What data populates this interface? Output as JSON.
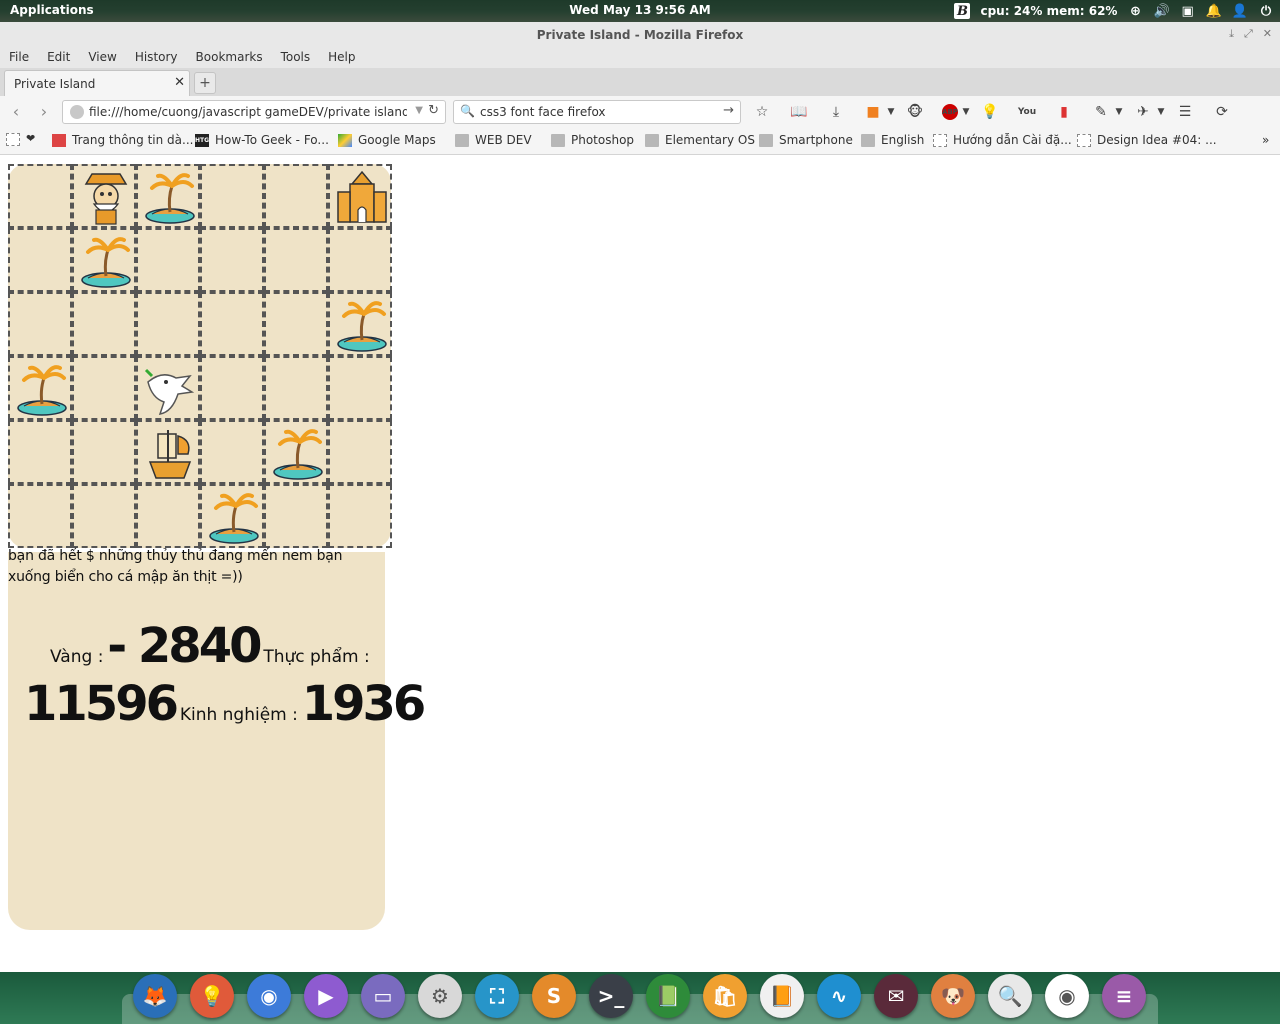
{
  "panel": {
    "apps_label": "Applications",
    "clock": "Wed May 13  9:56 AM",
    "stats": "cpu: 24% mem: 62%"
  },
  "window": {
    "title": "Private Island - Mozilla Firefox"
  },
  "menu": [
    "File",
    "Edit",
    "View",
    "History",
    "Bookmarks",
    "Tools",
    "Help"
  ],
  "tab": {
    "label": "Private Island"
  },
  "nav": {
    "url": "file:///home/cuong/javascript gameDEV/private island/index",
    "search": "css3 font face firefox"
  },
  "bookmarks": [
    {
      "label": "",
      "icon": "page"
    },
    {
      "label": "Trang thông tin dà...",
      "icon": "red"
    },
    {
      "label": "How-To Geek - Fo...",
      "icon": "htg"
    },
    {
      "label": "Google Maps",
      "icon": "maps"
    },
    {
      "label": "WEB DEV",
      "icon": "folder"
    },
    {
      "label": "Photoshop",
      "icon": "folder"
    },
    {
      "label": "Elementary OS",
      "icon": "folder"
    },
    {
      "label": "Smartphone",
      "icon": "folder"
    },
    {
      "label": "English",
      "icon": "folder"
    },
    {
      "label": "Hướng dẫn Cài đặ...",
      "icon": "page"
    },
    {
      "label": "Design Idea #04: ...",
      "icon": "page"
    }
  ],
  "map": {
    "grid_cols": 6,
    "grid_rows": 6,
    "tiles": [
      [
        "empty",
        "pirate",
        "island",
        "empty",
        "empty",
        "castle"
      ],
      [
        "empty",
        "island",
        "empty",
        "empty",
        "empty",
        "empty"
      ],
      [
        "empty",
        "empty",
        "empty",
        "empty",
        "empty",
        "island"
      ],
      [
        "island",
        "empty",
        "dragon",
        "empty",
        "empty",
        "empty"
      ],
      [
        "empty",
        "empty",
        "ship",
        "empty",
        "island",
        "empty"
      ],
      [
        "empty",
        "empty",
        "empty",
        "island",
        "empty",
        "empty"
      ]
    ]
  },
  "game": {
    "message": "bạn đã hết $ những thủy thủ đang mến nem bạn xuống biển cho cá mập ăn thịt =))",
    "gold_label": "Vàng :",
    "gold_value": "- 2840",
    "food_label": "Thực phẩm :",
    "food_value": "11596",
    "exp_label": "Kinh nghiệm :",
    "exp_value": "1936"
  },
  "dock": [
    {
      "name": "firefox",
      "color": "#2a6fb8"
    },
    {
      "name": "tips",
      "color": "#e05a3a"
    },
    {
      "name": "chromium",
      "color": "#3d7bd9"
    },
    {
      "name": "video-player",
      "color": "#8e5bd0"
    },
    {
      "name": "files",
      "color": "#7a6bbf"
    },
    {
      "name": "settings",
      "color": "#d8d8d8"
    },
    {
      "name": "screenshot",
      "color": "#2795c9"
    },
    {
      "name": "sublime",
      "color": "#e48a2a"
    },
    {
      "name": "terminal",
      "color": "#3a3f48"
    },
    {
      "name": "books",
      "color": "#2e8b3a"
    },
    {
      "name": "software",
      "color": "#f0a030"
    },
    {
      "name": "reader",
      "color": "#f0f0f0"
    },
    {
      "name": "monitor",
      "color": "#1f8fd0"
    },
    {
      "name": "mail",
      "color": "#5a2a3a"
    },
    {
      "name": "gimp",
      "color": "#e08040"
    },
    {
      "name": "search",
      "color": "#e8e8e8"
    },
    {
      "name": "chrome",
      "color": "#ffffff"
    },
    {
      "name": "text-editor",
      "color": "#9a5aa8"
    }
  ]
}
